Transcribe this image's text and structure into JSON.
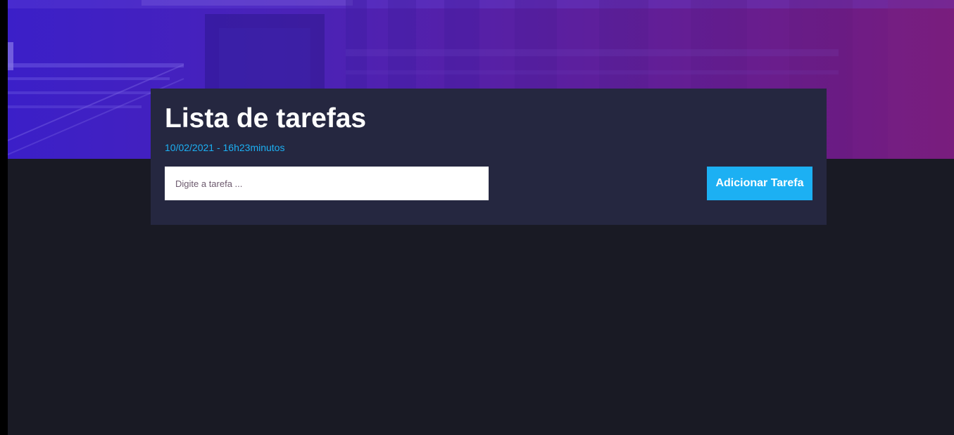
{
  "header": {
    "title": "Lista de tarefas",
    "date": "10/02/2021 - 16h23minutos"
  },
  "task_form": {
    "input_value": "",
    "input_placeholder": "Digite a tarefa ...",
    "add_button_label": "Adicionar Tarefa"
  },
  "colors": {
    "accent": "#1cb0f3",
    "card_background": "#252740",
    "page_background": "#191a24",
    "hero_gradient_start": "#3b1fc8",
    "hero_gradient_end": "#761b7c"
  }
}
